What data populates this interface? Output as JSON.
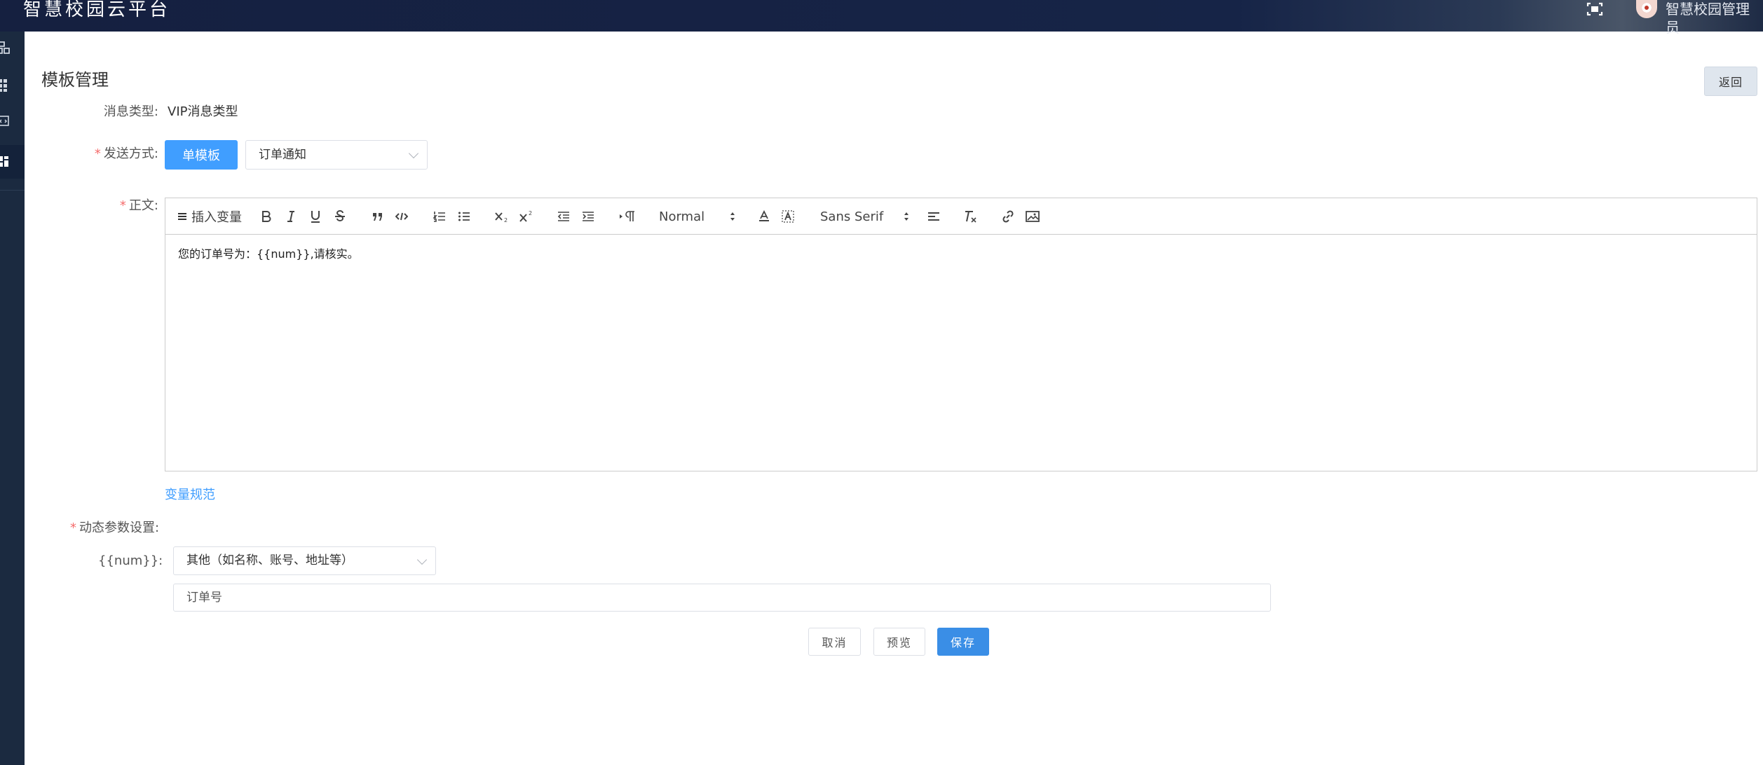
{
  "app": {
    "title": "智慧校园云平台",
    "user_name": "智慧校园管理员"
  },
  "page": {
    "title": "模板管理",
    "back_label": "返回"
  },
  "form": {
    "message_type": {
      "label": "消息类型:",
      "value": "VIP消息类型"
    },
    "send_method": {
      "label": "发送方式:",
      "template_button": "单模板",
      "select_value": "订单通知"
    },
    "body": {
      "label": "正文:",
      "content": "您的订单号为：{{num}},请核实。",
      "toolbar": {
        "insert_variable": "插入变量",
        "size_select": "Normal",
        "font_select": "Sans Serif"
      }
    },
    "variable_rules_link": "变量规范",
    "dynamic_params": {
      "label": "动态参数设置:",
      "param_label": "{{num}}:",
      "param_type": "其他（如名称、账号、地址等）",
      "param_value": "订单号"
    }
  },
  "actions": {
    "cancel": "取消",
    "preview": "预览",
    "save": "保存"
  },
  "colors": {
    "primary": "#409eff",
    "topbar": "#162447",
    "sidebar": "#1b2a40",
    "required": "#f56c6c"
  }
}
